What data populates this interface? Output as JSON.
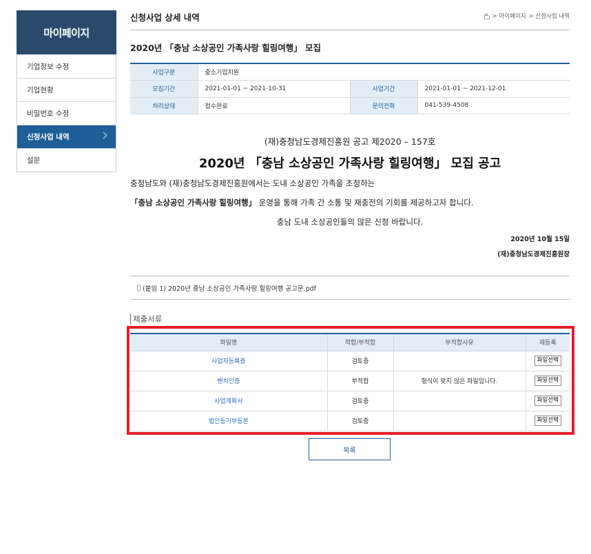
{
  "sidebar": {
    "title": "마이페이지",
    "items": [
      {
        "label": "기업정보 수정"
      },
      {
        "label": "기업현황"
      },
      {
        "label": "비밀번호 수정"
      },
      {
        "label": "신청사업 내역"
      },
      {
        "label": "설문"
      }
    ],
    "active_index": 3
  },
  "header": {
    "title": "신청사업 상세 내역",
    "breadcrumb": [
      "> 마이페이지",
      "> 신청사업 내역"
    ]
  },
  "notice_title": "2020년 「충남 소상공인 가족사랑 힐링여행」 모집",
  "info": {
    "business_type_label": "사업구분",
    "business_type": "중소기업지원",
    "recruit_period_label": "모집기간",
    "recruit_period": "2021-01-01 ~ 2021-10-31",
    "business_period_label": "사업기간",
    "business_period": "2021-01-01 ~ 2021-12-01",
    "status_label": "처리상태",
    "status": "접수완료",
    "contact_label": "문의전화",
    "contact": "041-539-4508"
  },
  "announcement": {
    "org_line": "(재)충청남도경제진흥원 공고 제2020 – 157호",
    "title": "2020년 「충남 소상공인 가족사랑 힐링여행」 모집 공고",
    "line1": "충청남도와 (재)충청남도경제진흥원에서는 도내 소상공인 가족을 초청하는",
    "line2_bold": "「충남 소상공인 가족사랑 힐링여행」",
    "line2_rest": " 운영을 통해 가족 간 소통 및 재충전의 기회를 제공하고자 합니다.",
    "line3": "충남 도내 소상공인들의 많은 신청 바랍니다.",
    "date": "2020년 10월 15일",
    "signature": "(재)충청남도경제진흥원장"
  },
  "attachment": {
    "file": "(붙임 1) 2020년 충남 소상공인 가족사랑 힐링여행 공고문.pdf"
  },
  "docs": {
    "section_label": "제출서류",
    "columns": [
      "파일명",
      "적합/부적합",
      "부적합사유",
      "재등록"
    ],
    "button_label": "파일선택",
    "rows": [
      {
        "name": "사업자등록증",
        "result": "검토중",
        "reason": ""
      },
      {
        "name": "벤처인증",
        "result": "부적합",
        "reason": "형식이 맞지 않은 파일입니다."
      },
      {
        "name": "사업계획서",
        "result": "검토중",
        "reason": ""
      },
      {
        "name": "법인등기부등본",
        "result": "검토중",
        "reason": ""
      }
    ]
  },
  "list_button": "목록",
  "colors": {
    "sidebar_header": "#2b4a6b",
    "accent": "#1f5f99",
    "highlight_frame": "#e3202a",
    "link": "#2a6fc4"
  }
}
